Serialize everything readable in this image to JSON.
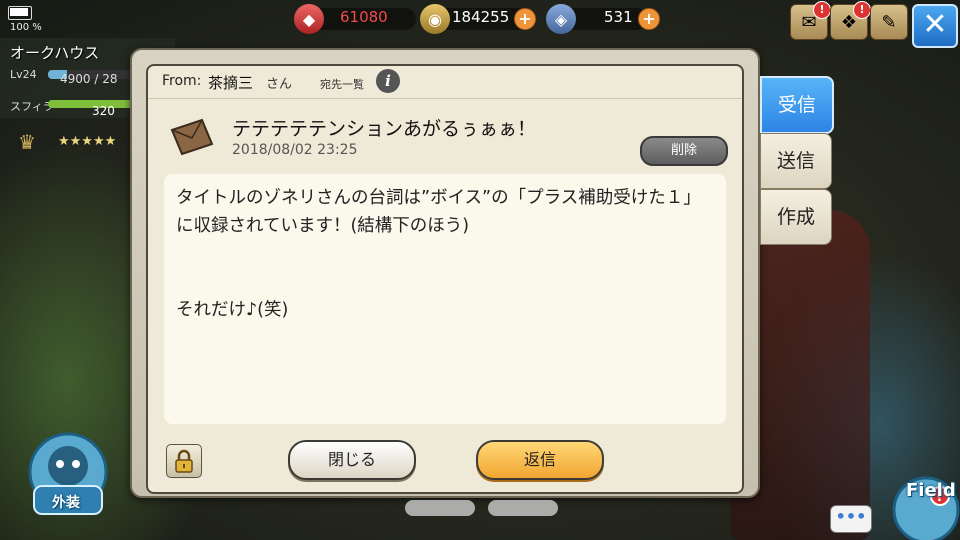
{
  "status": {
    "battery": "100 %"
  },
  "player": {
    "name": "オークハウス",
    "level": "Lv24",
    "exp": "4900 / 28",
    "exp_fraction": 0.19,
    "stamina_label": "スフィラ",
    "stamina_value": "320",
    "stamina_fraction": 0.9,
    "stars": "★★★★★"
  },
  "currency": {
    "gems": "61080",
    "coins": "184255",
    "crystals": "531"
  },
  "colors": {
    "accent_blue": "#2d84e4",
    "reply_orange": "#f1a531",
    "gem_red": "#d33a3a"
  },
  "mail": {
    "from_label": "From:",
    "from_name": "茶摘三",
    "from_suffix": "さん",
    "recipients_label": "宛先一覧",
    "subject": "テテテテテンションあがるぅぁぁ！",
    "date": "2018/08/02 23:25",
    "delete_label": "削除",
    "body": "タイトルのゾネリさんの台詞は”ボイス”の「プラス補助受けた１」に収録されています！(結構下のほう)\n\n\nそれだけ♪(笑)",
    "close_label": "閉じる",
    "reply_label": "返信"
  },
  "tabs": {
    "inbox": "受信",
    "sent": "送信",
    "compose": "作成"
  },
  "bottom": {
    "gaiso": "外装",
    "field": "Field"
  }
}
